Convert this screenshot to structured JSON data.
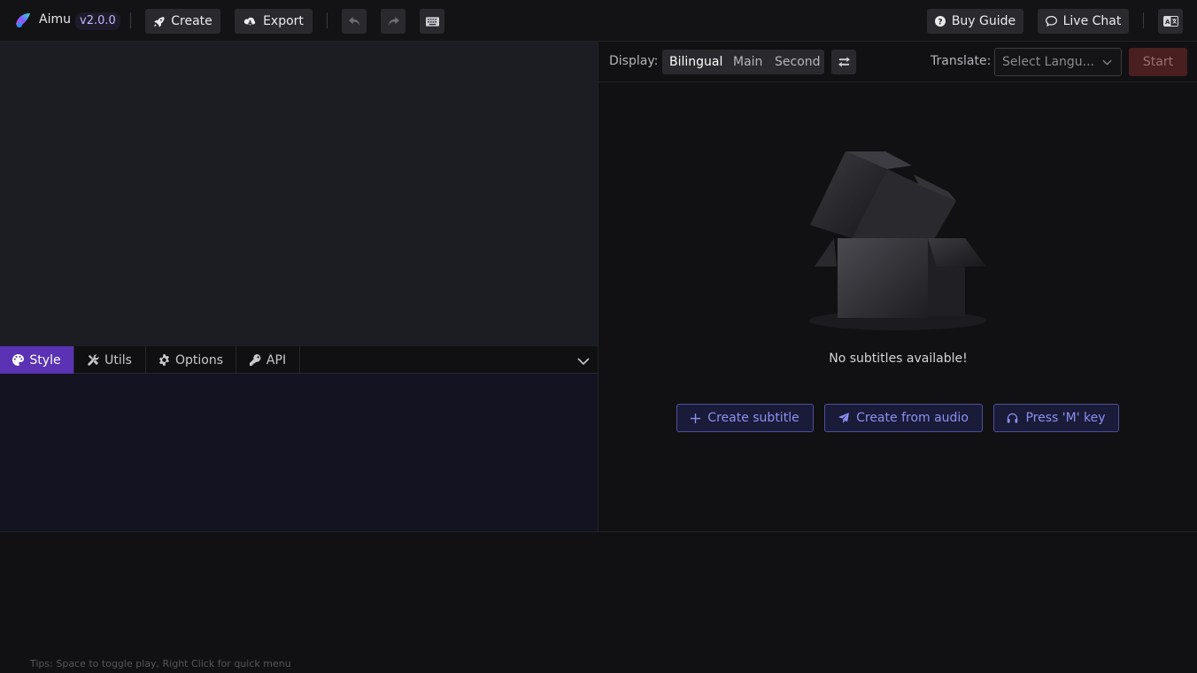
{
  "app": {
    "name": "Aimu",
    "version": "v2.0.0"
  },
  "toolbar": {
    "create_label": "Create",
    "export_label": "Export",
    "buy_guide_label": "Buy Guide",
    "live_chat_label": "Live Chat"
  },
  "icons": {
    "logo": "app-logo-icon",
    "create": "rocket-icon",
    "export": "cloud-download-icon",
    "undo": "undo-icon",
    "redo": "redo-icon",
    "keyboard": "keyboard-icon",
    "buy_guide": "question-circle-icon",
    "live_chat": "chat-bubble-icon",
    "language": "language-icon"
  },
  "tabs": [
    {
      "label": "Style",
      "icon": "palette-icon",
      "active": true
    },
    {
      "label": "Utils",
      "icon": "tools-icon",
      "active": false
    },
    {
      "label": "Options",
      "icon": "gear-icon",
      "active": false
    },
    {
      "label": "API",
      "icon": "key-icon",
      "active": false
    }
  ],
  "display": {
    "label": "Display:",
    "options": [
      "Bilingual",
      "Main",
      "Second"
    ],
    "selected": "Bilingual"
  },
  "translate": {
    "label": "Translate:",
    "placeholder": "Select Langu...",
    "start_label": "Start"
  },
  "empty_state": {
    "message": "No subtitles available!",
    "actions": [
      {
        "label": "Create subtitle",
        "icon": "plus-icon"
      },
      {
        "label": "Create from audio",
        "icon": "paper-plane-icon"
      },
      {
        "label": "Press 'M' key",
        "icon": "headphones-icon"
      }
    ]
  },
  "tips": "Tips: Space to toggle play, Right Click for quick menu",
  "colors": {
    "accent": "#5b32b4",
    "action_text": "#8b8ff0",
    "start_bg": "#4a1f1f",
    "background": "#111113"
  }
}
